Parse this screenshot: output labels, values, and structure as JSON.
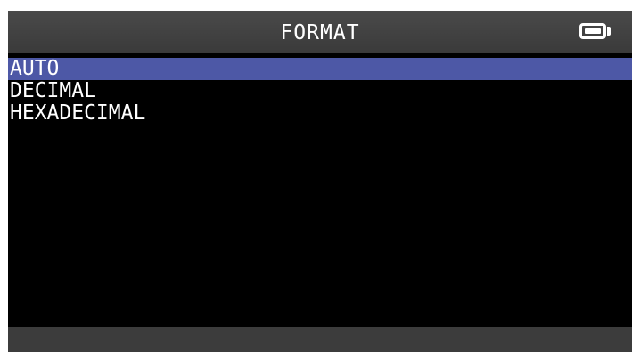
{
  "header": {
    "title": "FORMAT",
    "battery_icon": "battery-icon"
  },
  "menu": {
    "items": [
      {
        "label": "AUTO",
        "selected": true
      },
      {
        "label": "DECIMAL",
        "selected": false
      },
      {
        "label": "HEXADECIMAL",
        "selected": false
      }
    ]
  },
  "colors": {
    "screen_background": "#000000",
    "header_background": "#424242",
    "selection_highlight": "#4d58a6",
    "text": "#ffffff",
    "footer_background": "#3c3c3c"
  }
}
